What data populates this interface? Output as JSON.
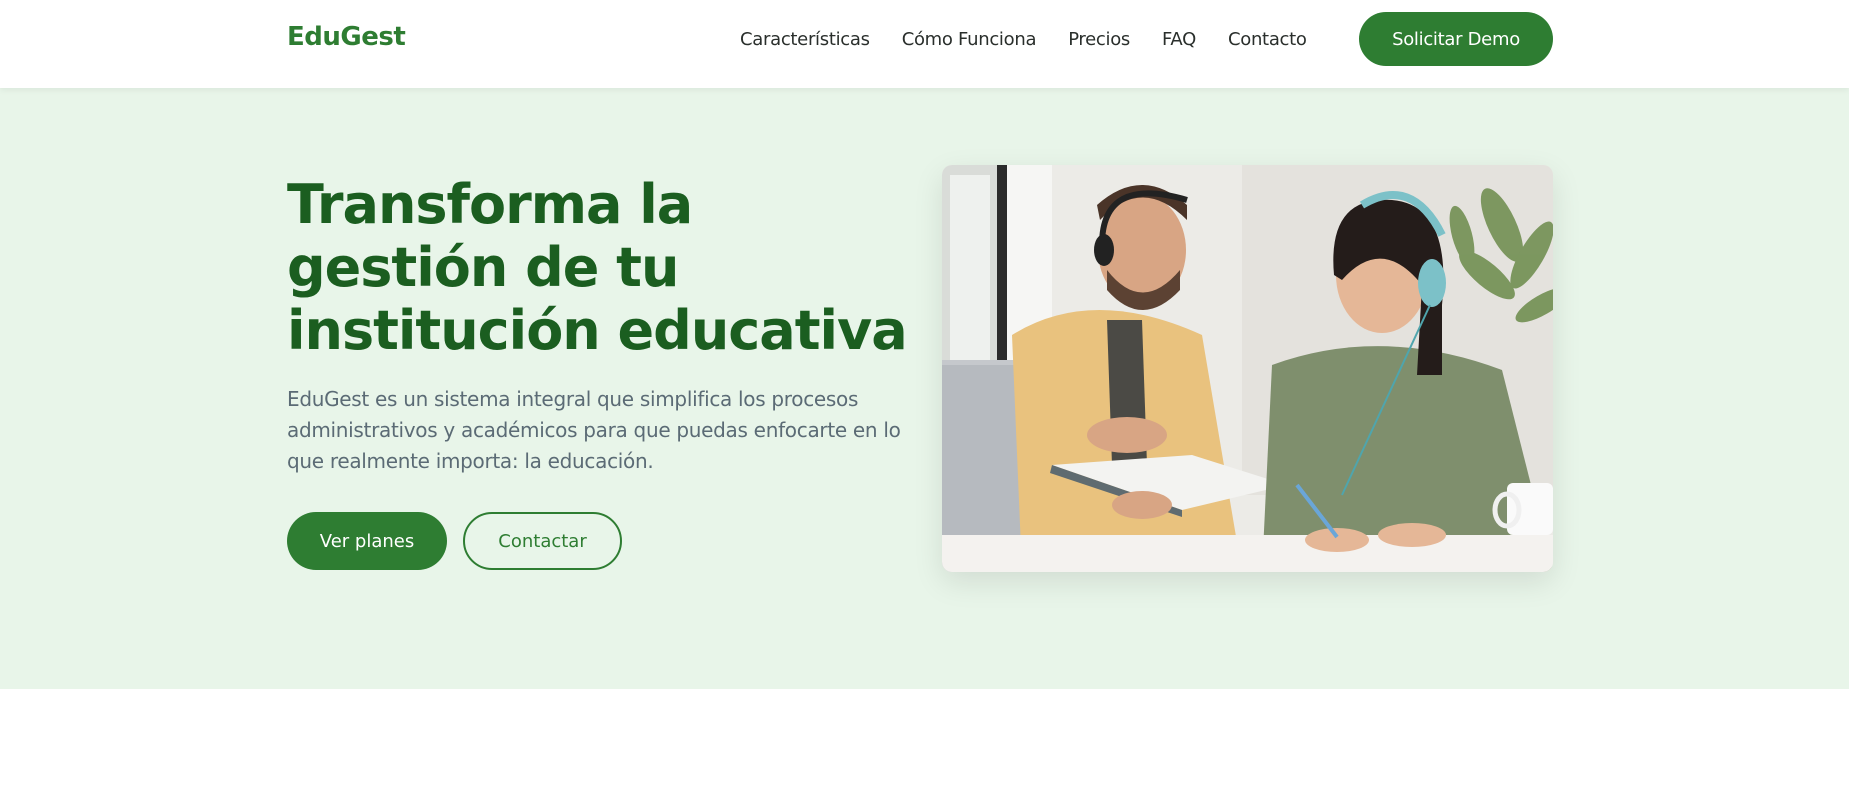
{
  "brand": {
    "logo": "EduGest",
    "accent": "#2e7d32",
    "dark_accent": "#1b5e20",
    "hero_bg": "#e8f5e9"
  },
  "nav": {
    "links": [
      "Características",
      "Cómo Funciona",
      "Precios",
      "FAQ",
      "Contacto"
    ],
    "cta": "Solicitar Demo"
  },
  "hero": {
    "title": "Transforma la gestión de tu institución educativa",
    "description": "EduGest es un sistema integral que simplifica los procesos administrativos y académicos para que puedas enfocarte en lo que realmente importa: la educación.",
    "primary_button": "Ver planes",
    "secondary_button": "Contactar"
  }
}
